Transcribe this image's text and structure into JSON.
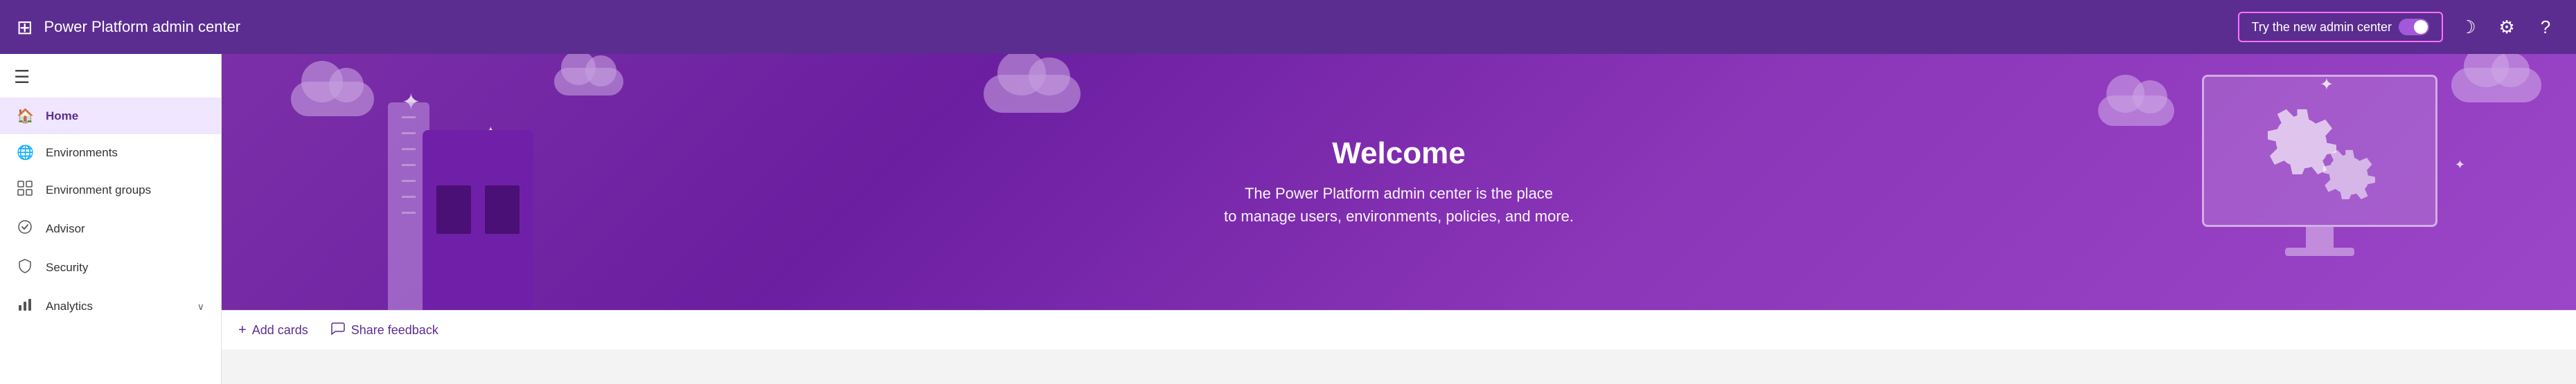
{
  "topbar": {
    "waffle": "⊞",
    "title": "Power Platform admin center",
    "try_new_admin_label": "Try the new admin center",
    "moon_icon": "☽",
    "settings_icon": "⚙",
    "help_icon": "?"
  },
  "sidebar": {
    "hamburger": "☰",
    "items": [
      {
        "id": "home",
        "label": "Home",
        "icon": "🏠",
        "active": true,
        "hasChevron": false
      },
      {
        "id": "environments",
        "label": "Environments",
        "icon": "🌐",
        "active": false,
        "hasChevron": false
      },
      {
        "id": "environment-groups",
        "label": "Environment groups",
        "icon": "📋",
        "active": false,
        "hasChevron": false
      },
      {
        "id": "advisor",
        "label": "Advisor",
        "icon": "◈",
        "active": false,
        "hasChevron": false
      },
      {
        "id": "security",
        "label": "Security",
        "icon": "🔒",
        "active": false,
        "hasChevron": false
      },
      {
        "id": "analytics",
        "label": "Analytics",
        "icon": "📊",
        "active": false,
        "hasChevron": true
      }
    ]
  },
  "banner": {
    "welcome_title": "Welcome",
    "subtitle_line1": "The Power Platform admin center is the place",
    "subtitle_line2": "to manage users, environments, policies, and more."
  },
  "toolbar": {
    "add_cards_label": "Add cards",
    "share_feedback_label": "Share feedback",
    "add_icon": "+",
    "feedback_icon": "🗨"
  }
}
